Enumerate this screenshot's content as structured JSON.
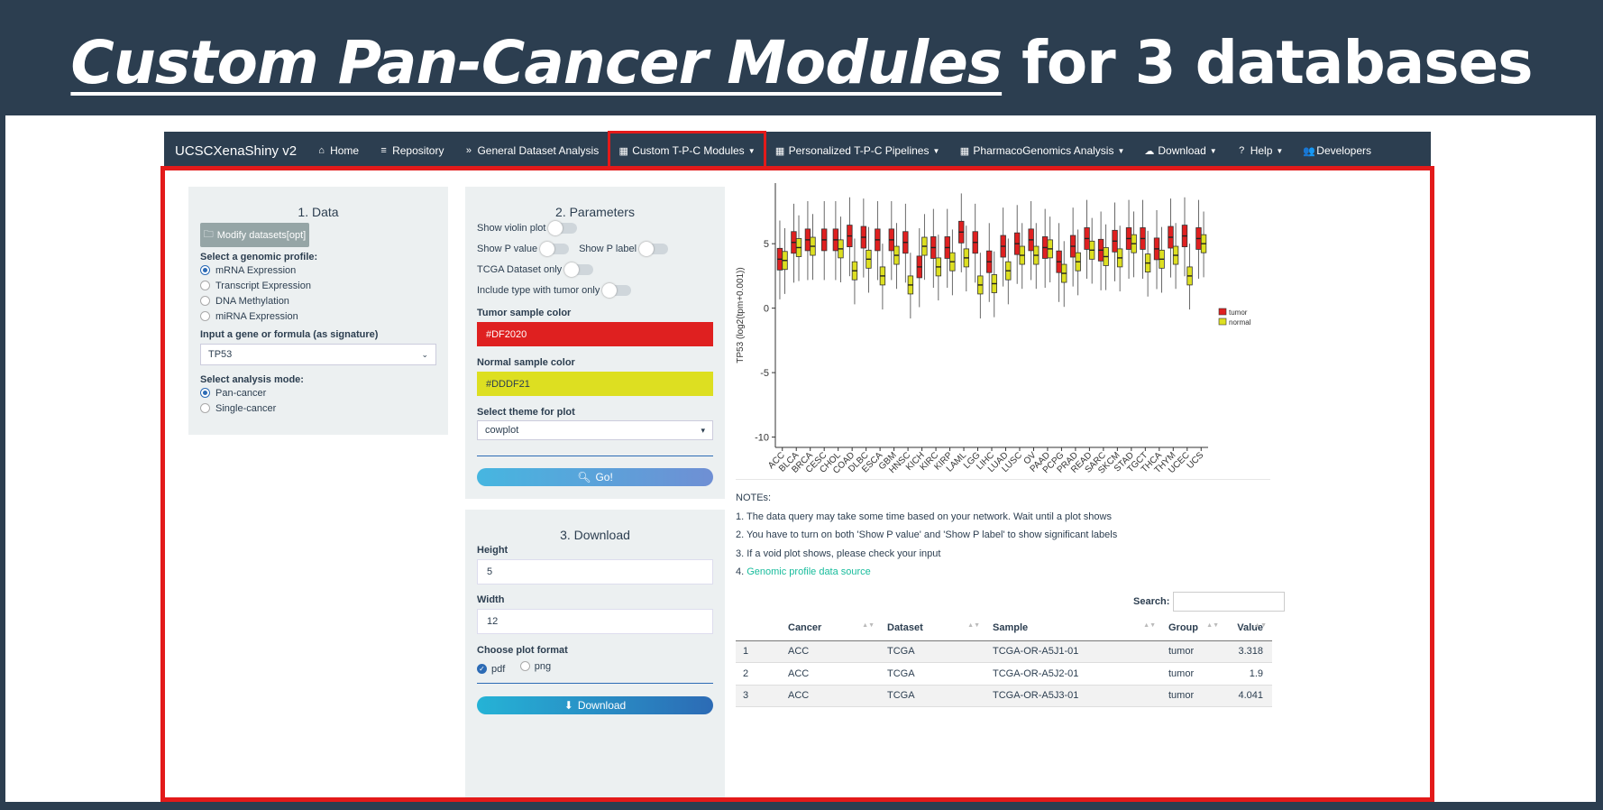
{
  "banner": {
    "title_em": "Custom Pan-Cancer  Modules",
    "title_rest": " for 3 databases"
  },
  "navbar": {
    "brand": "UCSCXenaShiny v2",
    "items": [
      {
        "label": "Home",
        "icon": "home-icon",
        "caret": false
      },
      {
        "label": "Repository",
        "icon": "database-icon",
        "caret": false
      },
      {
        "label": "General Dataset Analysis",
        "icon": "angles-down-icon",
        "caret": false
      },
      {
        "label": "Custom T-P-C Modules",
        "icon": "table-icon",
        "caret": true,
        "active": true
      },
      {
        "label": "Personalized T-P-C Pipelines",
        "icon": "table-icon",
        "caret": true
      },
      {
        "label": "PharmacoGenomics Analysis",
        "icon": "table-icon",
        "caret": true
      },
      {
        "label": "Download",
        "icon": "cloud-download-icon",
        "caret": true
      },
      {
        "label": "Help",
        "icon": "question-icon",
        "caret": true
      },
      {
        "label": "Developers",
        "icon": "users-icon",
        "caret": false
      }
    ]
  },
  "data_panel": {
    "title": "1. Data",
    "modify_button": "Modify datasets[opt]",
    "profile_label": "Select a genomic profile:",
    "profiles": [
      "mRNA Expression",
      "Transcript Expression",
      "DNA Methylation",
      "miRNA Expression"
    ],
    "profile_selected": 0,
    "gene_label": "Input a gene or formula (as signature)",
    "gene_value": "TP53",
    "mode_label": "Select analysis mode:",
    "modes": [
      "Pan-cancer",
      "Single-cancer"
    ],
    "mode_selected": 0
  },
  "params_panel": {
    "title": "2. Parameters",
    "show_violin": "Show violin plot",
    "show_p_value": "Show P value",
    "show_p_label": "Show P label",
    "tcga_only": "TCGA Dataset only",
    "include_tumor_only": "Include type with tumor only",
    "tumor_color_label": "Tumor sample color",
    "tumor_color": "#DF2020",
    "normal_color_label": "Normal sample color",
    "normal_color": "#DDDF21",
    "theme_label": "Select theme for plot",
    "theme_value": "cowplot",
    "go_button": "Go!"
  },
  "download_panel": {
    "title": "3. Download",
    "height_label": "Height",
    "height_value": "5",
    "width_label": "Width",
    "width_value": "12",
    "format_label": "Choose plot format",
    "formats": [
      "pdf",
      "png"
    ],
    "format_selected": 0,
    "download_button": "Download"
  },
  "chart_data": {
    "type": "boxplot",
    "ylabel": "TP53 (log2(tpm+0.001))",
    "yticks": [
      5,
      0,
      -5,
      -10
    ],
    "ylim": [
      -10.8,
      9.7
    ],
    "legend": [
      "tumor",
      "normal"
    ],
    "legend_position": "right",
    "colors": {
      "tumor": "#DF2020",
      "normal": "#DDDF21"
    },
    "categories": [
      "ACC",
      "BLCA",
      "BRCA",
      "CESC",
      "CHOL",
      "COAD",
      "DLBC",
      "ESCA",
      "GBM",
      "HNSC",
      "KICH",
      "KIRC",
      "KIRP",
      "LAML",
      "LGG",
      "LIHC",
      "LUAD",
      "LUSC",
      "OV",
      "PAAD",
      "PCPG",
      "PRAD",
      "READ",
      "SARC",
      "SKCM",
      "STAD",
      "TGCT",
      "THCA",
      "THYM",
      "UCEC",
      "UCS"
    ],
    "series": [
      {
        "name": "tumor",
        "values": [
          3.8,
          5.1,
          5.3,
          5.3,
          5.3,
          5.6,
          5.5,
          5.3,
          5.3,
          5.1,
          3.2,
          4.7,
          4.7,
          5.9,
          5.1,
          3.6,
          4.8,
          5.0,
          5.3,
          4.7,
          3.6,
          4.8,
          5.4,
          4.5,
          5.2,
          5.4,
          5.4,
          4.6,
          5.5,
          5.6,
          5.4
        ]
      },
      {
        "name": "normal",
        "values": [
          3.7,
          4.7,
          4.8,
          null,
          4.6,
          2.9,
          3.8,
          2.5,
          4.1,
          1.8,
          4.8,
          3.2,
          3.6,
          3.9,
          1.8,
          1.9,
          2.9,
          4.1,
          4.1,
          4.6,
          2.7,
          3.6,
          4.5,
          4.0,
          3.9,
          5.0,
          3.5,
          3.8,
          4.1,
          2.5,
          5.0
        ]
      }
    ]
  },
  "notes": {
    "title": "NOTEs:",
    "items": [
      "1. The data query may take some time based on your network. Wait until a plot shows",
      "2. You have to turn on both 'Show P value' and 'Show P label' to show significant labels",
      "3. If a void plot shows, please check your input"
    ],
    "link_prefix": "4. ",
    "link_text": "Genomic profile data source"
  },
  "table": {
    "search_label": "Search:",
    "columns": [
      "",
      "Cancer",
      "Dataset",
      "Sample",
      "Group",
      "Value"
    ],
    "rows": [
      [
        "1",
        "ACC",
        "TCGA",
        "TCGA-OR-A5J1-01",
        "tumor",
        "3.318"
      ],
      [
        "2",
        "ACC",
        "TCGA",
        "TCGA-OR-A5J2-01",
        "tumor",
        "1.9"
      ],
      [
        "3",
        "ACC",
        "TCGA",
        "TCGA-OR-A5J3-01",
        "tumor",
        "4.041"
      ]
    ]
  }
}
